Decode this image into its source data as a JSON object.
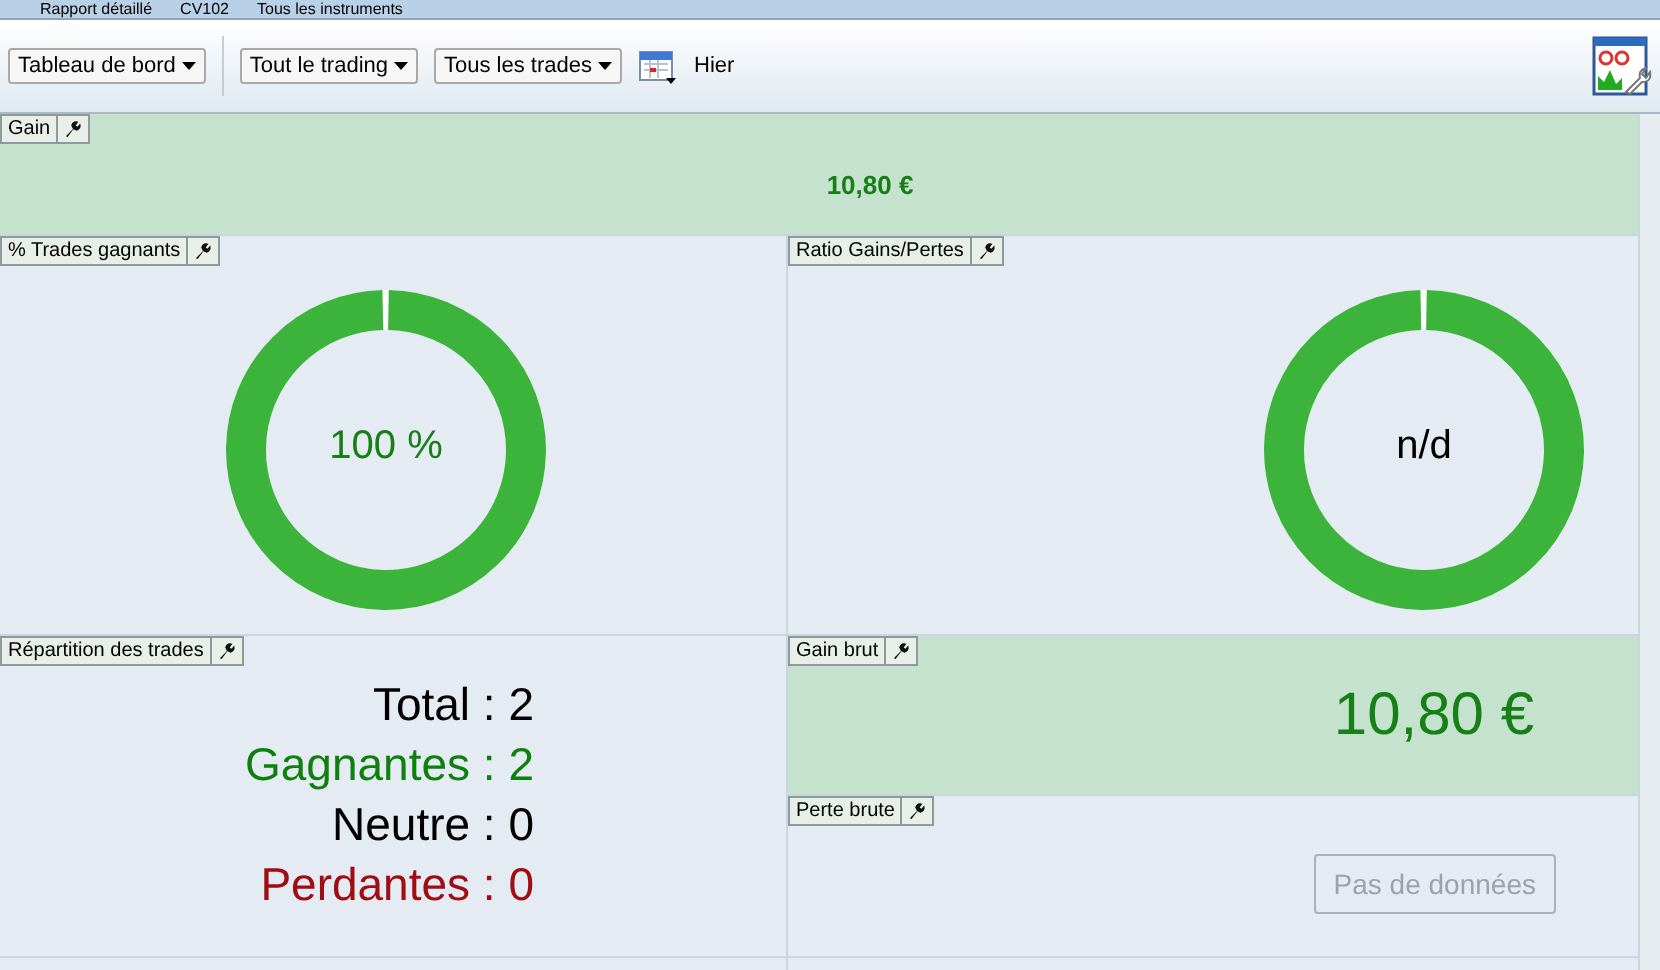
{
  "top_tabs": [
    "Rapport détaillé",
    "CV102",
    "Tous les instruments"
  ],
  "toolbar": {
    "dropdowns": [
      "Tableau de bord",
      "Tout le trading",
      "Tous les trades"
    ],
    "date_label": "Hier"
  },
  "gain": {
    "title": "Gain",
    "value": "10,80 €"
  },
  "donuts": [
    {
      "title": "% Trades gagnants",
      "center": "100 %",
      "color": "#168016"
    },
    {
      "title": "Ratio Gains/Pertes",
      "center": "n/d",
      "color": "#000000"
    }
  ],
  "repartition": {
    "title": "Répartition des trades",
    "rows": [
      {
        "text": "Total : 2",
        "color": "#000000"
      },
      {
        "text": "Gagnantes : 2",
        "color": "#0f800f"
      },
      {
        "text": "Neutre : 0",
        "color": "#000000"
      },
      {
        "text": "Perdantes : 0",
        "color": "#a00d12"
      }
    ]
  },
  "gross_gain": {
    "title": "Gain brut",
    "value": "10,80 €"
  },
  "gross_loss": {
    "title": "Perte brute",
    "empty_button": "Pas de données",
    "disabled": true
  }
}
